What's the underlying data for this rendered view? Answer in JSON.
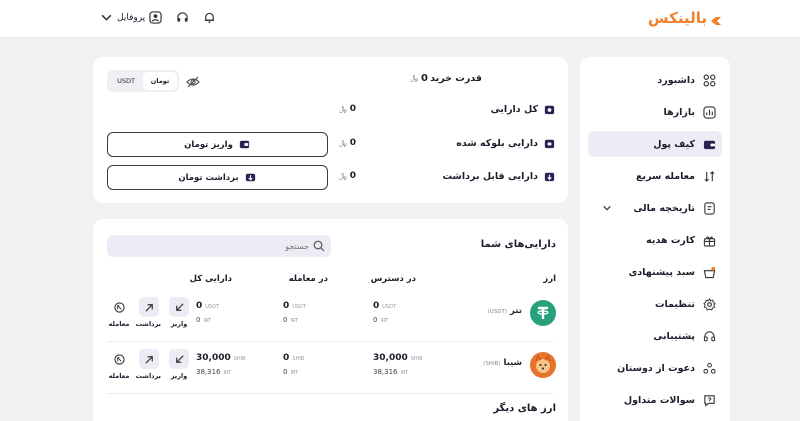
{
  "header": {
    "logo": "بالینکس",
    "profile_label": "پروفایل",
    "icons": [
      "bell-icon",
      "headset-icon",
      "user-icon",
      "chevron-down-icon"
    ]
  },
  "sidebar": {
    "items": [
      {
        "label": "داشبورد",
        "icon": "grid-icon"
      },
      {
        "label": "بازارها",
        "icon": "chart-icon"
      },
      {
        "label": "کیف پول",
        "icon": "wallet-icon",
        "active": true
      },
      {
        "label": "معامله سریع",
        "icon": "swap-icon"
      },
      {
        "label": "تاریخچه مالی",
        "icon": "history-icon",
        "has_submenu": true
      },
      {
        "label": "کارت هدیه",
        "icon": "gift-icon"
      },
      {
        "label": "سبد پیشنهادی",
        "icon": "basket-icon"
      },
      {
        "label": "تنظیمات",
        "icon": "gear-icon"
      },
      {
        "label": "پشتیبانی",
        "icon": "headset-icon"
      },
      {
        "label": "دعوت از دوستان",
        "icon": "users-icon"
      },
      {
        "label": "سوالات متداول",
        "icon": "question-icon"
      }
    ]
  },
  "balance": {
    "buying_power_label": "قدرت خرید",
    "buying_power_value": "0",
    "total_label": "کل دارایی",
    "total_value": "0",
    "blocked_label": "دارایی بلوکه شده",
    "blocked_value": "0",
    "withdrawable_label": "دارایی قابل برداشت",
    "withdrawable_value": "0",
    "deposit_button": "واریز تومان",
    "withdraw_button": "برداشت تومان",
    "toggle": {
      "left": "USDT",
      "right": "تومان",
      "selected": "تومان"
    }
  },
  "assets": {
    "title": "دارایی‌های شما",
    "search_placeholder": "جستجو",
    "columns": [
      "ارز",
      "در دسترس",
      "در معامله",
      "دارایی کل"
    ],
    "rows": [
      {
        "name": "تتر",
        "symbol": "(USDT)",
        "icon_color": "#27a17c",
        "available": "0",
        "available_unit": "USDT",
        "available_toman": "0",
        "available_toman_unit": "IRT",
        "in_trade": "0",
        "in_trade_unit": "USDT",
        "in_trade_toman": "0",
        "in_trade_toman_unit": "IRT",
        "total": "0",
        "total_unit": "USDT",
        "total_toman": "0",
        "total_toman_unit": "IRT"
      },
      {
        "name": "شیبا",
        "symbol": "(SHIB)",
        "icon_color": "#e8732a",
        "available": "30,000",
        "available_unit": "SHIB",
        "available_toman": "38,316",
        "available_toman_unit": "IRT",
        "in_trade": "0",
        "in_trade_unit": "SHIB",
        "in_trade_toman": "0",
        "in_trade_toman_unit": "IRT",
        "total": "30,000",
        "total_unit": "SHIB",
        "total_toman": "38,316",
        "total_toman_unit": "IRT"
      }
    ],
    "actions": {
      "deposit": "واریز",
      "withdraw": "برداشت",
      "trade": "معامله"
    },
    "other_title": "ارز های دیگر"
  }
}
